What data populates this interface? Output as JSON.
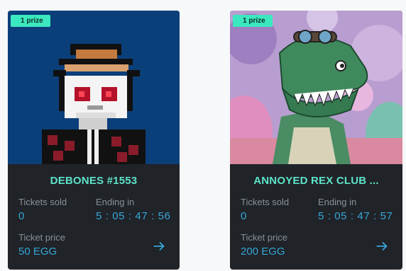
{
  "cards": [
    {
      "badge": "1 prize",
      "title": "DEBONES #1553",
      "tickets_sold_label": "Tickets sold",
      "tickets_sold": "0",
      "ending_label": "Ending in",
      "ending": "5 : 05 : 47 : 56",
      "price_label": "Ticket price",
      "price": "50 EGG",
      "artwork": "pixel-skull-with-hat"
    },
    {
      "badge": "1 prize",
      "title": "ANNOYED REX CLUB ...",
      "tickets_sold_label": "Tickets sold",
      "tickets_sold": "0",
      "ending_label": "Ending in",
      "ending": "5 : 05 : 47 : 57",
      "price_label": "Ticket price",
      "price": "200 EGG",
      "artwork": "green-trex-with-goggles"
    }
  ],
  "icons": {
    "arrow": "arrow-right-icon"
  },
  "colors": {
    "card_bg": "#202328",
    "title": "#5de4c7",
    "value": "#36a7d8",
    "label": "#8b9099",
    "badge_bg": "#3ce8c0"
  }
}
